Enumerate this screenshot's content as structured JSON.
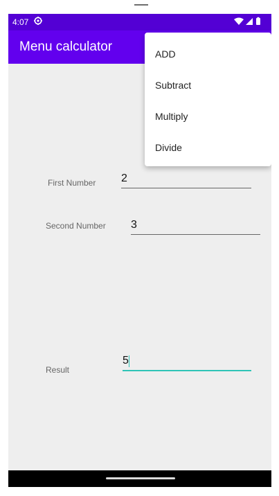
{
  "status_bar": {
    "time": "4:07",
    "settings_icon": "settings-gear-icon",
    "wifi_icon": "wifi-icon",
    "signal_icon": "cell-signal-icon",
    "battery_icon": "battery-icon"
  },
  "app_bar": {
    "title": "Menu calculator"
  },
  "menu": {
    "items": [
      {
        "label": "ADD"
      },
      {
        "label": "Subtract"
      },
      {
        "label": "Multiply"
      },
      {
        "label": "Divide"
      }
    ]
  },
  "form": {
    "first": {
      "label": "First Number",
      "value": "2"
    },
    "second": {
      "label": "Second Number",
      "value": "3"
    },
    "result": {
      "label": "Result",
      "value": "5"
    }
  },
  "colors": {
    "status_bar": "#5300d4",
    "app_bar": "#6200ee",
    "accent": "#2ec4b6",
    "background": "#eeeeee"
  }
}
